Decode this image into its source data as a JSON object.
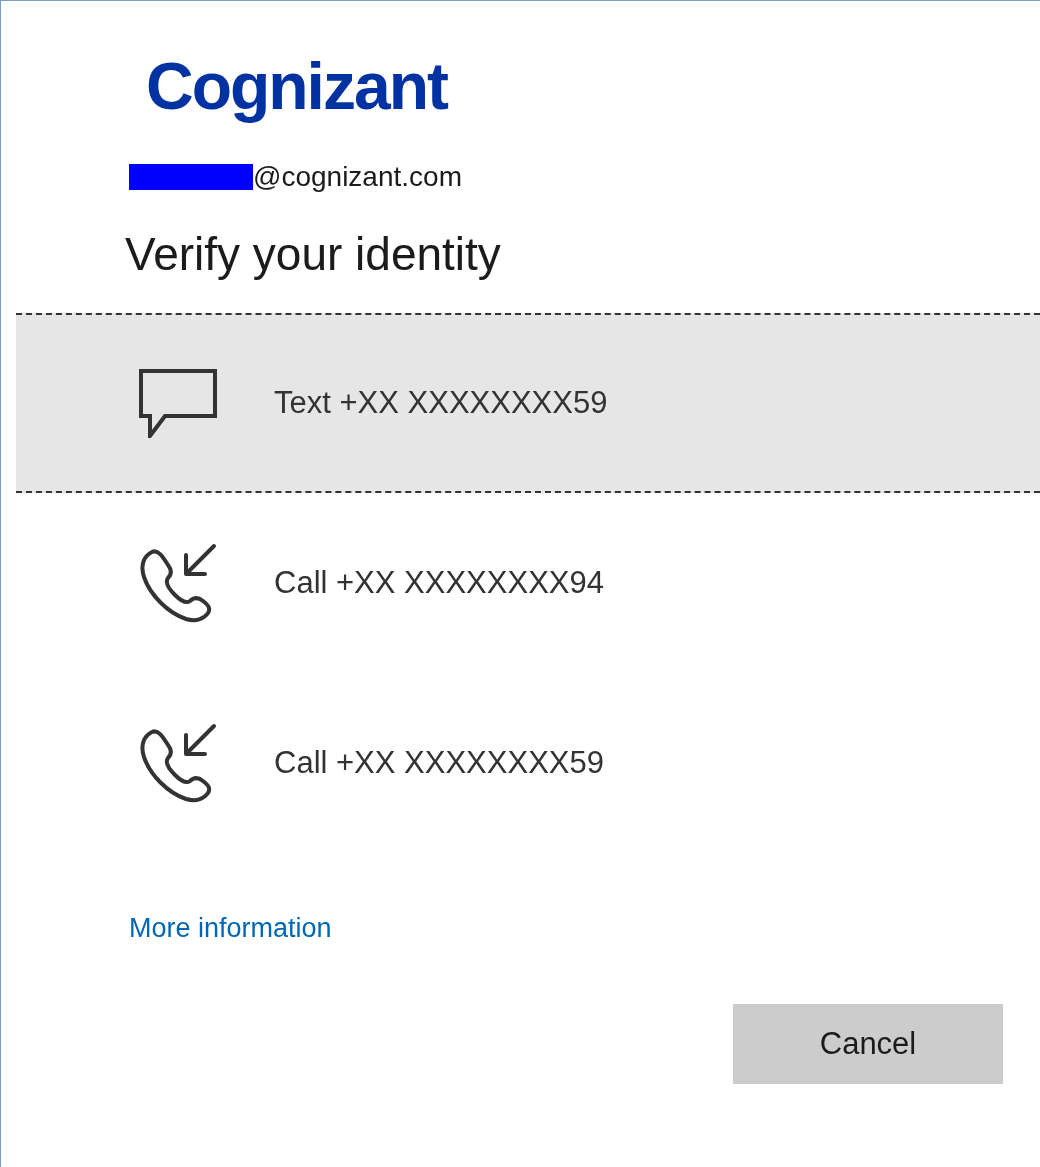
{
  "logo": {
    "text": "Cognizant"
  },
  "account": {
    "email": "@cognizant.com",
    "redacted": true
  },
  "title": "Verify your identity",
  "options": [
    {
      "kind": "text",
      "label": "Text +XX XXXXXXXX59",
      "selected": true
    },
    {
      "kind": "call",
      "label": "Call +XX XXXXXXXX94",
      "selected": false
    },
    {
      "kind": "call",
      "label": "Call +XX XXXXXXXX59",
      "selected": false
    }
  ],
  "more_link": "More information",
  "buttons": [
    {
      "label": "Cancel"
    }
  ]
}
